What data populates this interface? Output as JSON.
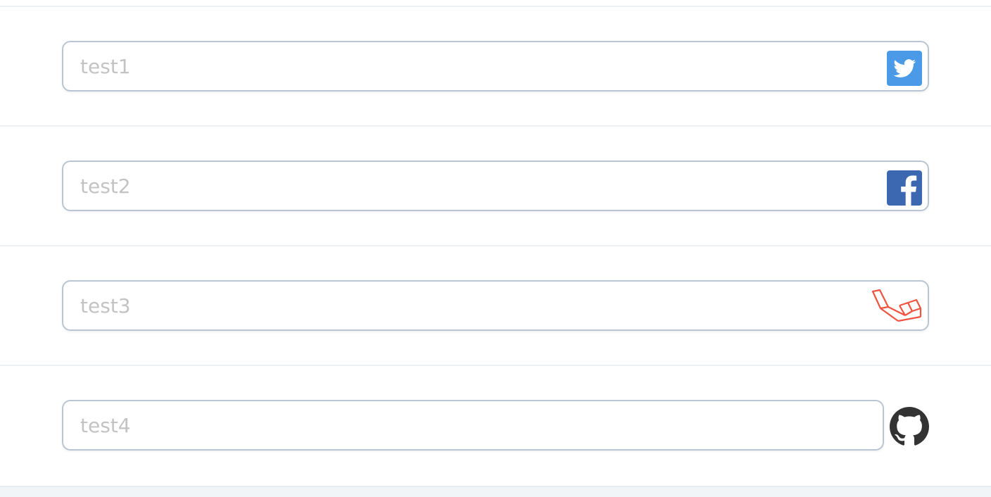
{
  "fields": [
    {
      "placeholder": "test1",
      "value": "",
      "icon": "twitter-icon",
      "icon_color": "#4a9ae8"
    },
    {
      "placeholder": "test2",
      "value": "",
      "icon": "facebook-icon",
      "icon_color": "#3b68b0"
    },
    {
      "placeholder": "test3",
      "value": "",
      "icon": "laravel-icon",
      "icon_color": "#f05340"
    },
    {
      "placeholder": "test4",
      "value": "",
      "icon": "github-icon",
      "icon_color": "#333333"
    }
  ],
  "colors": {
    "input_border": "#b8c5d3",
    "placeholder": "#c3c3c3",
    "divider": "#eef1f4",
    "background": "#ffffff"
  }
}
